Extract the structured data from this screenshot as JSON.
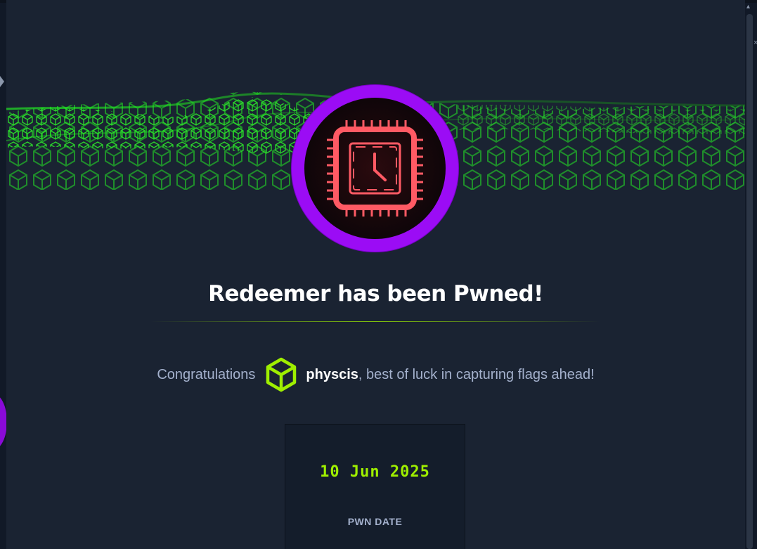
{
  "machine": {
    "title": "Redeemer has been Pwned!"
  },
  "congrats": {
    "prefix": "Congratulations",
    "username": "physcis",
    "suffix": ", best of luck in capturing flags ahead!"
  },
  "stat": {
    "value": "10 Jun 2025",
    "label": "PWN DATE"
  },
  "colors": {
    "accent_green": "#9fef00",
    "avatar_ring": "#9b0cf5",
    "chip_red": "#ff4d5e",
    "background": "#1a2332"
  },
  "icons": {
    "user_rank": "cube-icon",
    "machine_avatar": "chip-clock-icon"
  }
}
